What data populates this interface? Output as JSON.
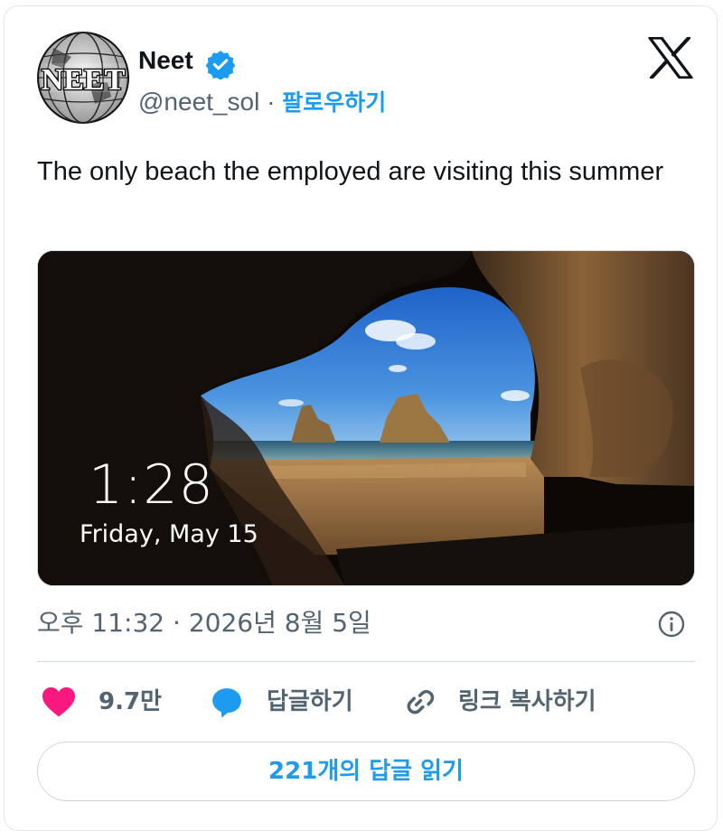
{
  "user": {
    "display_name": "Neet",
    "handle": "@neet_sol",
    "separator": " · ",
    "follow_label": "팔로우하기",
    "verified": true,
    "avatar_icon": "neet-globe-logo-avatar"
  },
  "platform_icon": "x-logo-icon",
  "tweet": {
    "text": "The only beach the employed are visiting this summer",
    "timestamp": "오후 11:32 · 2026년 8월 5일"
  },
  "media": {
    "lock_time": "1:28",
    "lock_date": "Friday, May 15"
  },
  "actions": {
    "like_count": "9.7만",
    "reply_label": "답글하기",
    "copy_link_label": "링크 복사하기"
  },
  "read_replies_label": "221개의 답글 읽기",
  "colors": {
    "accent": "#1d9bf0",
    "like": "#f91880",
    "text": "#0f1419",
    "secondary": "#536471",
    "border": "#cfd9de"
  }
}
